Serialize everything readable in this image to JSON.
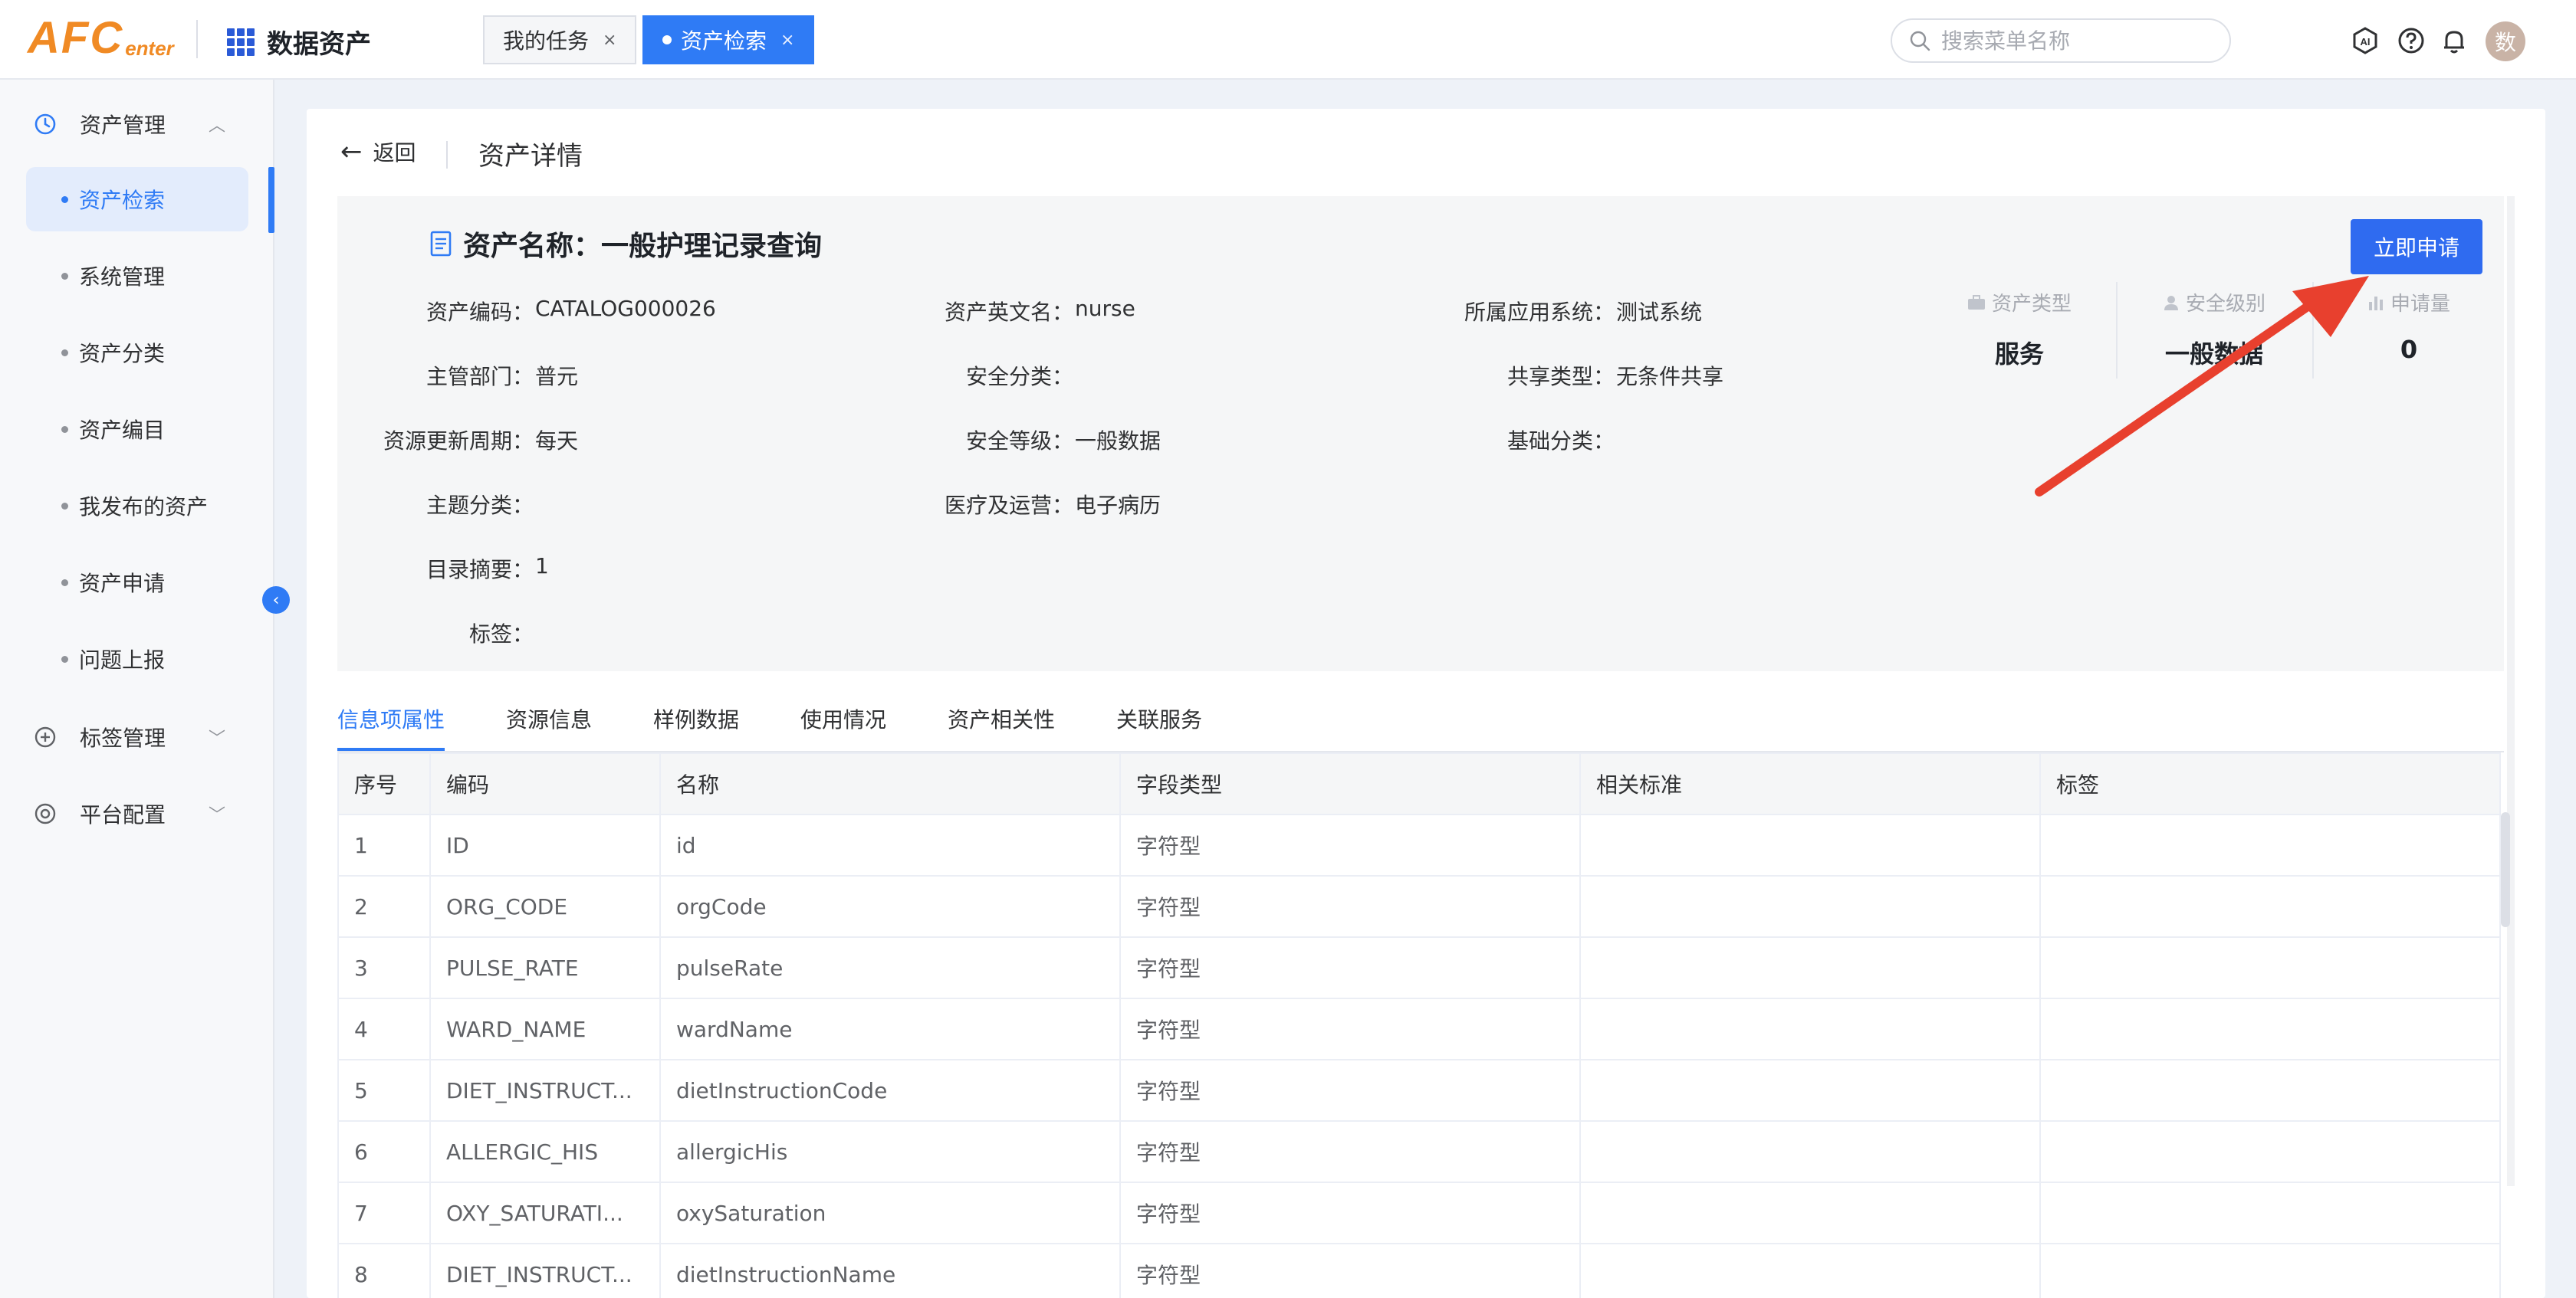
{
  "header": {
    "logo_big": "AFC",
    "logo_small": "enter",
    "app_title": "数据资产",
    "tabs": [
      {
        "label": "我的任务",
        "close": "×"
      },
      {
        "label": "资产检索",
        "close": "×"
      }
    ],
    "search_placeholder": "搜索菜单名称",
    "avatar_text": "数"
  },
  "sidebar": {
    "groups": [
      {
        "label": "资产管理",
        "chevron": "︿"
      },
      {
        "label": "标签管理",
        "chevron": "﹀"
      },
      {
        "label": "平台配置",
        "chevron": "﹀"
      }
    ],
    "items": [
      {
        "label": "资产检索"
      },
      {
        "label": "系统管理"
      },
      {
        "label": "资产分类"
      },
      {
        "label": "资产编目"
      },
      {
        "label": "我发布的资产"
      },
      {
        "label": "资产申请"
      },
      {
        "label": "问题上报"
      }
    ],
    "collapse_glyph": "‹"
  },
  "page": {
    "back_label": "返回",
    "title": "资产详情",
    "asset_name_label": "资产名称：",
    "asset_name": "一般护理记录查询",
    "apply_button": "立即申请",
    "fields": {
      "code": {
        "label": "资产编码：",
        "value": "CATALOG000026"
      },
      "english_name": {
        "label": "资产英文名：",
        "value": "nurse"
      },
      "app_system": {
        "label": "所属应用系统：",
        "value": "测试系统"
      },
      "dept": {
        "label": "主管部门：",
        "value": "普元"
      },
      "security_class": {
        "label": "安全分类：",
        "value": ""
      },
      "share_type": {
        "label": "共享类型：",
        "value": "无条件共享"
      },
      "update_cycle": {
        "label": "资源更新周期：",
        "value": "每天"
      },
      "security_level": {
        "label": "安全等级：",
        "value": "一般数据"
      },
      "base_class": {
        "label": "基础分类：",
        "value": ""
      },
      "topic_class": {
        "label": "主题分类：",
        "value": ""
      },
      "medical_ops": {
        "label": "医疗及运营：",
        "value": "电子病历"
      },
      "summary": {
        "label": "目录摘要：",
        "value": "1"
      },
      "tags": {
        "label": "标签：",
        "value": ""
      }
    },
    "stats": [
      {
        "title": "资产类型",
        "value": "服务"
      },
      {
        "title": "安全级别",
        "value": "一般数据"
      },
      {
        "title": "申请量",
        "value": "0"
      }
    ]
  },
  "tabs": [
    {
      "label": "信息项属性"
    },
    {
      "label": "资源信息"
    },
    {
      "label": "样例数据"
    },
    {
      "label": "使用情况"
    },
    {
      "label": "资产相关性"
    },
    {
      "label": "关联服务"
    }
  ],
  "table": {
    "headers": [
      "序号",
      "编码",
      "名称",
      "字段类型",
      "相关标准",
      "标签"
    ],
    "rows": [
      [
        "1",
        "ID",
        "id",
        "字符型",
        "",
        ""
      ],
      [
        "2",
        "ORG_CODE",
        "orgCode",
        "字符型",
        "",
        ""
      ],
      [
        "3",
        "PULSE_RATE",
        "pulseRate",
        "字符型",
        "",
        ""
      ],
      [
        "4",
        "WARD_NAME",
        "wardName",
        "字符型",
        "",
        ""
      ],
      [
        "5",
        "DIET_INSTRUCT...",
        "dietInstructionCode",
        "字符型",
        "",
        ""
      ],
      [
        "6",
        "ALLERGIC_HIS",
        "allergicHis",
        "字符型",
        "",
        ""
      ],
      [
        "7",
        "OXY_SATURATI...",
        "oxySaturation",
        "字符型",
        "",
        ""
      ],
      [
        "8",
        "DIET_INSTRUCT...",
        "dietInstructionName",
        "字符型",
        "",
        ""
      ]
    ]
  },
  "colors": {
    "accent": "#2f7bf5",
    "logo": "#f08a24",
    "annotation_arrow": "#e8402e"
  },
  "icons": {
    "search": "search-icon",
    "ai": "ai-icon",
    "help": "help-icon",
    "bell": "bell-icon",
    "clock": "clock-icon",
    "plus_circle": "plus-circle-icon",
    "target": "target-icon",
    "document": "document-icon"
  }
}
